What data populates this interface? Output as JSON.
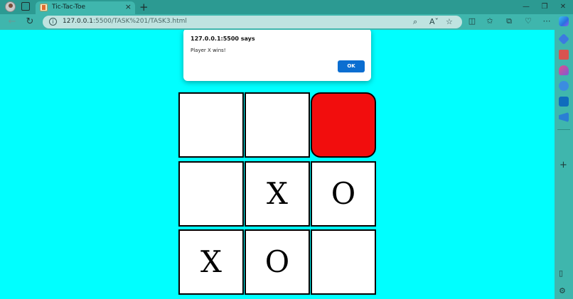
{
  "browser": {
    "tab_title": "Tic-Tac-Toe",
    "tab_close": "×",
    "new_tab": "+",
    "url_host": "127.0.0.1",
    "url_rest": ":5500/TASK%201/TASK3.html",
    "window": {
      "minimize": "—",
      "restore": "❐",
      "close": "✕"
    }
  },
  "dialog": {
    "origin": "127.0.0.1:5500 says",
    "message": "Player X wins!",
    "ok_label": "OK"
  },
  "board": {
    "cells": [
      "",
      "",
      "",
      "",
      "X",
      "O",
      "X",
      "O",
      ""
    ],
    "highlighted_cell_index": 2,
    "highlight_color": "#f20d0d"
  },
  "colors": {
    "page_background": "#00ffff",
    "browser_chrome": "#3fb6ad",
    "ok_button": "#0b6ed1"
  },
  "icons": {
    "profile": "profile-avatar-icon",
    "tabs": "tab-actions-icon",
    "favicon": "page-favicon-icon",
    "back": "back-arrow-icon",
    "refresh": "refresh-icon",
    "info": "site-info-icon",
    "zoom": "zoom-icon",
    "read_aloud": "read-aloud-icon",
    "favorite": "favorite-star-icon",
    "split": "split-screen-icon",
    "favorites": "favorites-icon",
    "collections": "collections-icon",
    "extensions": "browser-essentials-icon",
    "menu": "more-menu-icon",
    "copilot": "copilot-icon"
  }
}
